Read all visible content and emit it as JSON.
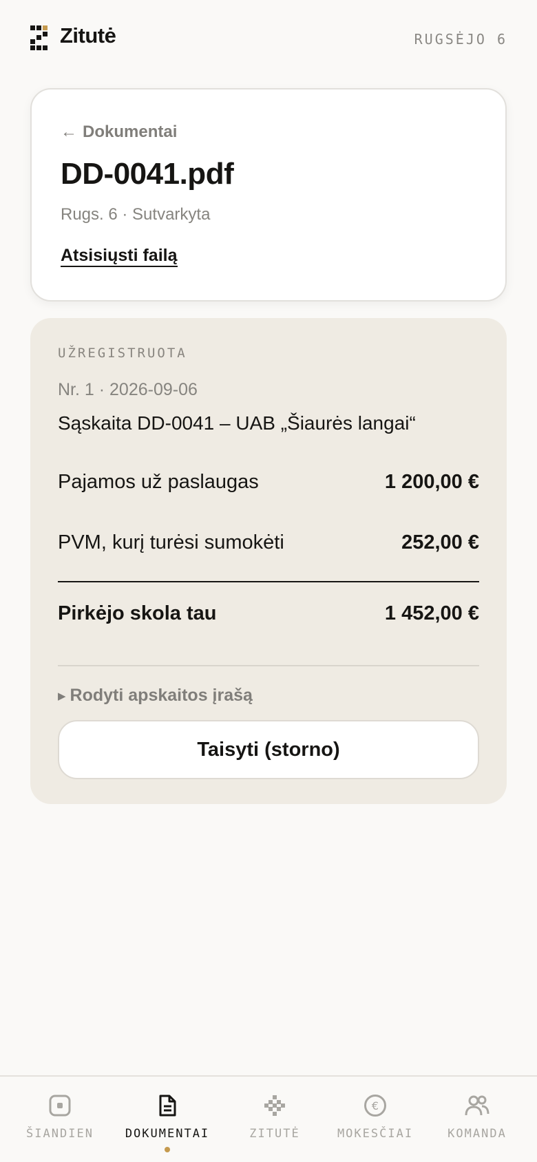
{
  "app": {
    "brand": "Zitutė",
    "date": "RUGSĖJO 6"
  },
  "document": {
    "back_label": "Dokumentai",
    "back_arrow": "←",
    "title": "DD-0041.pdf",
    "meta": "Rugs. 6 · Sutvarkyta",
    "download_label": "Atsisiųsti failą"
  },
  "entry": {
    "status": "UŽREGISTRUOTA",
    "number_line": "Nr. 1 · 2026-09-06",
    "description": "Sąskaita DD-0041 – UAB „Šiaurės langai“",
    "rows": [
      {
        "label": "Pajamos už paslaugas",
        "amount": "1 200,00 €"
      },
      {
        "label": "PVM, kurį turėsi sumokėti",
        "amount": "252,00 €"
      }
    ],
    "total": {
      "label": "Pirkėjo skola tau",
      "amount": "1 452,00 €"
    },
    "toggle_label": "Rodyti apskaitos įrašą",
    "storno_label": "Taisyti (storno)"
  },
  "nav": {
    "items": [
      {
        "label": "ŠIANDIEN",
        "icon": "today-icon",
        "active": false
      },
      {
        "label": "DOKUMENTAI",
        "icon": "document-icon",
        "active": true
      },
      {
        "label": "ZITUTĖ",
        "icon": "sparkle-icon",
        "active": false
      },
      {
        "label": "MOKESČIAI",
        "icon": "euro-icon",
        "active": false
      },
      {
        "label": "KOMANDA",
        "icon": "team-icon",
        "active": false
      }
    ]
  },
  "colors": {
    "accent": "#c59a4e",
    "text": "#161513",
    "muted": "#86847f",
    "card_beige": "#efebe3",
    "background": "#faf9f7"
  }
}
